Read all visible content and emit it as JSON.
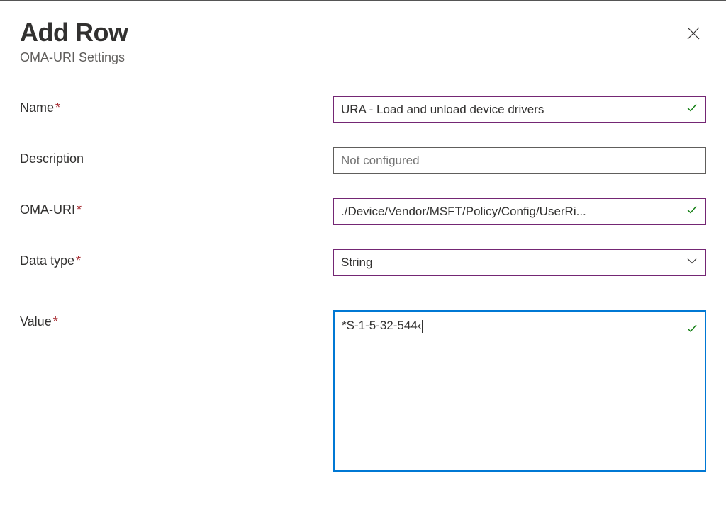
{
  "header": {
    "title": "Add Row",
    "subtitle": "OMA-URI Settings"
  },
  "form": {
    "name": {
      "label": "Name",
      "required": true,
      "value": "URA - Load and unload device drivers",
      "validated": true
    },
    "description": {
      "label": "Description",
      "required": false,
      "value": "",
      "placeholder": "Not configured",
      "validated": false
    },
    "oma_uri": {
      "label": "OMA-URI",
      "required": true,
      "value": "./Device/Vendor/MSFT/Policy/Config/UserRi...",
      "validated": true
    },
    "data_type": {
      "label": "Data type",
      "required": true,
      "value": "String",
      "validated": true
    },
    "value": {
      "label": "Value",
      "required": true,
      "value": "*S-1-5-32-544‹",
      "validated": true
    }
  },
  "icons": {
    "checkmark_color": "#107c10",
    "chevron_color": "#323130"
  }
}
